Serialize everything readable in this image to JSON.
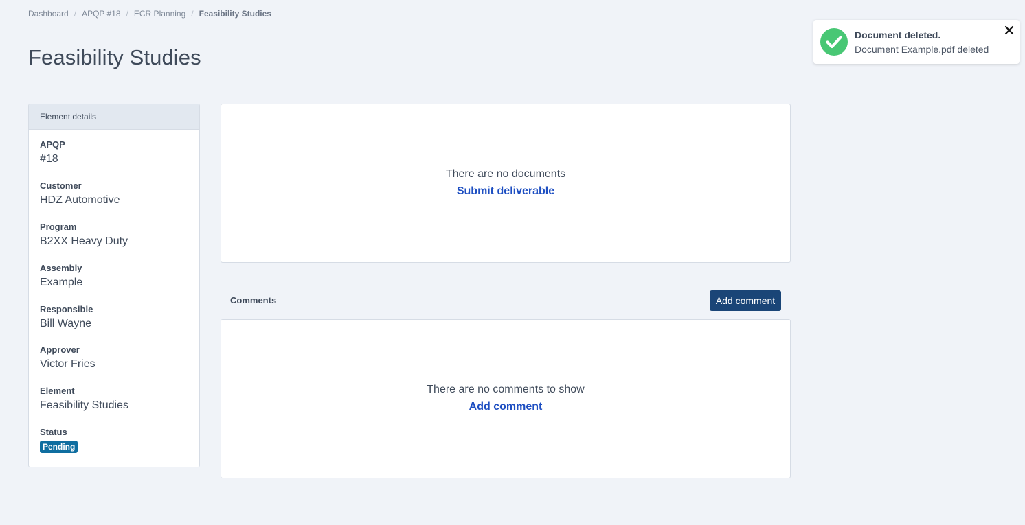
{
  "breadcrumb": {
    "items": [
      "Dashboard",
      "APQP #18",
      "ECR Planning"
    ],
    "current": "Feasibility Studies",
    "separator": "/"
  },
  "page": {
    "title": "Feasibility Studies"
  },
  "details": {
    "header": "Element details",
    "fields": [
      {
        "label": "APQP",
        "value": "#18"
      },
      {
        "label": "Customer",
        "value": "HDZ Automotive"
      },
      {
        "label": "Program",
        "value": "B2XX Heavy Duty"
      },
      {
        "label": "Assembly",
        "value": "Example"
      },
      {
        "label": "Responsible",
        "value": "Bill Wayne"
      },
      {
        "label": "Approver",
        "value": "Victor Fries"
      },
      {
        "label": "Element",
        "value": "Feasibility Studies"
      }
    ],
    "status": {
      "label": "Status",
      "value": "Pending",
      "color": "#0f6ea0"
    }
  },
  "documents": {
    "empty_text": "There are no documents",
    "action_label": "Submit deliverable"
  },
  "comments": {
    "title": "Comments",
    "add_button_label": "Add comment",
    "empty_text": "There are no comments to show",
    "action_label": "Add comment"
  },
  "toast": {
    "title": "Document deleted.",
    "message": "Document Example.pdf deleted",
    "icon": "check-circle-icon",
    "close_icon": "close-icon",
    "success_color": "#48c774"
  },
  "colors": {
    "background": "#f0f3f8",
    "primary_button": "#1a4577",
    "link": "#1e4fc2"
  }
}
